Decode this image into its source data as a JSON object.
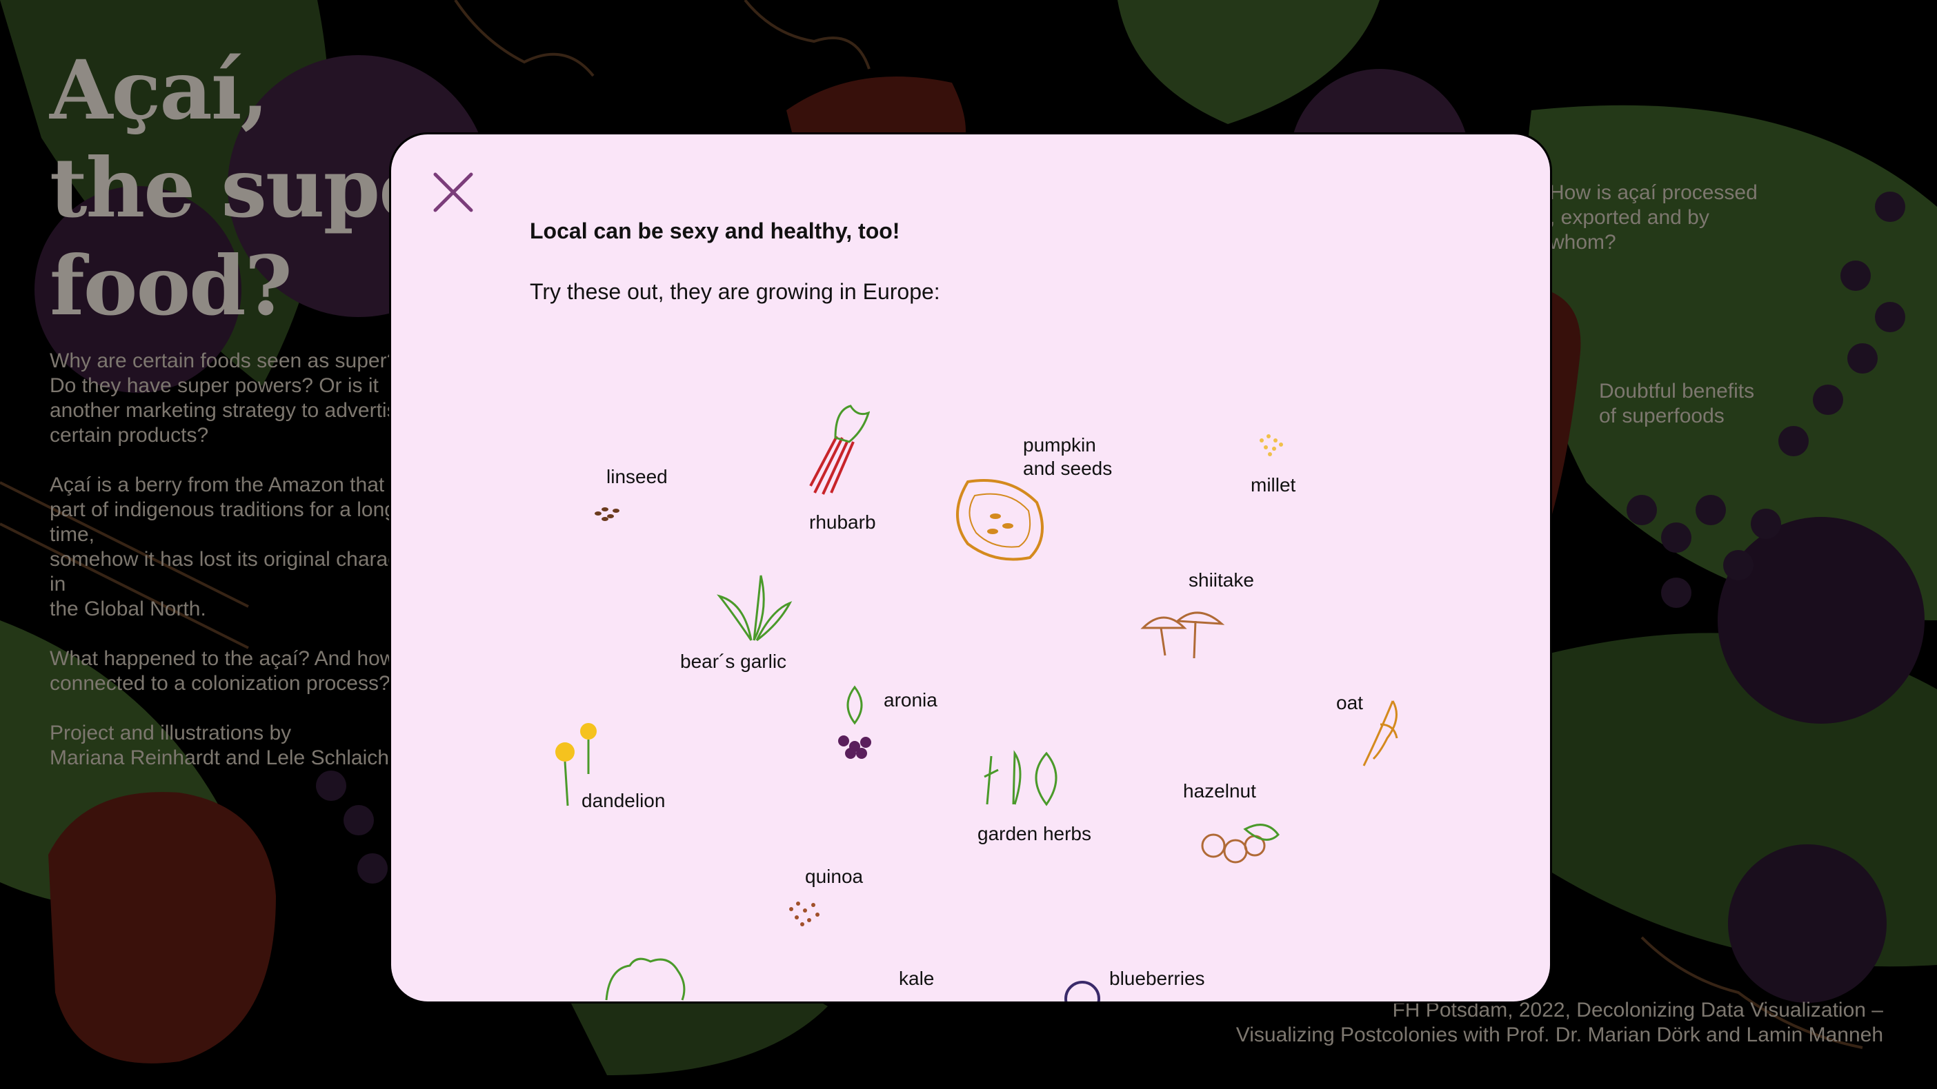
{
  "page": {
    "title_lines": [
      "Açaí,",
      "the super",
      "food?"
    ],
    "intro_paragraphs": [
      "Why are certain foods seen as super?\nDo they have super powers? Or is it\nanother marketing strategy to advertise\ncertain products?",
      "Açaí is a berry from the Amazon that is\npart of indigenous traditions for a long time,\nsomehow it has lost its original character in\nthe Global North.",
      "What happened to the açaí? And how is it\nconnected to a colonization process?",
      "Project and illustrations by\nMariana Reinhardt and Lele Schlaich"
    ],
    "side_link_1": "How is açaí processed\n, exported and by\nwhom?",
    "side_link_2": "Doubtful benefits\nof superfoods",
    "footer": "FH Potsdam, 2022, Decolonizing Data Visualization –\nVisualizing Postcolonies with Prof. Dr. Marian Dörk and Lamin Manneh"
  },
  "modal": {
    "close_icon": "close-x-icon",
    "heading": "Local can be sexy and healthy, too!",
    "subheading": "Try these out, they are growing in Europe:",
    "foods": {
      "linseed": "linseed",
      "rhubarb": "rhubarb",
      "pumpkin": "pumpkin\nand seeds",
      "millet": "millet",
      "bears_garlic": "bear´s garlic",
      "shiitake": "shiitake",
      "aronia": "aronia",
      "oat": "oat",
      "dandelion": "dandelion",
      "garden_herbs": "garden herbs",
      "hazelnut": "hazelnut",
      "quinoa": "quinoa",
      "kale": "kale",
      "blueberries": "blueberries"
    }
  },
  "colors": {
    "modal_bg": "#fae5f8",
    "close_icon": "#7b3c7a",
    "leaf": "#2e4a1e",
    "berry": "#3a1f3c",
    "fruit": "#5e1c12"
  }
}
